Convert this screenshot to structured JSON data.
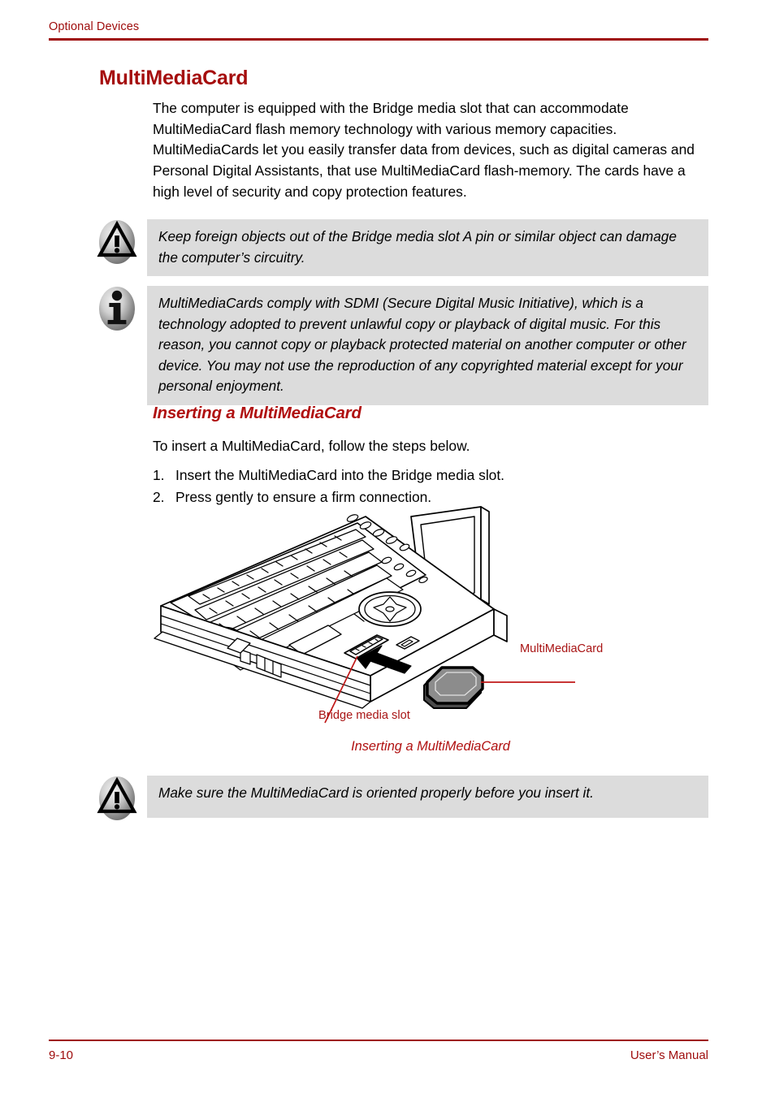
{
  "header": {
    "running_head": "Optional Devices",
    "rule_color": "#9E0B0B"
  },
  "heading": {
    "title": "MultiMediaCard",
    "color": "#A50D0D"
  },
  "intro": {
    "paragraph": "The computer is equipped with the Bridge media slot that can accommodate MultiMediaCard flash memory technology with various memory capacities. MultiMediaCards let you easily transfer data from devices, such as digital cameras and Personal Digital Assistants, that use MultiMediaCard flash-memory. The cards have a high level of security and copy protection features."
  },
  "callouts": {
    "caution_slot": {
      "icon": "warning-triangle-icon",
      "text": "Keep foreign objects out of the Bridge media slot A pin or similar object can damage the computer’s circuitry.",
      "background": "#DCDCDC"
    },
    "note_sdmi": {
      "icon": "info-i-icon",
      "text": "MultiMediaCards comply with SDMI (Secure Digital Music Initiative), which is a technology adopted to prevent unlawful copy or playback of digital music. For this reason, you cannot copy or playback protected material on another computer or other device. You may not use the reproduction of any copyrighted material except for your personal enjoyment.",
      "background": "#DCDCDC"
    },
    "caution_orientation": {
      "icon": "warning-triangle-icon",
      "text": "Make sure the MultiMediaCard is oriented properly before you insert it.",
      "background": "#DCDCDC"
    }
  },
  "subsection": {
    "title": "Inserting a MultiMediaCard",
    "lead": "To insert a MultiMediaCard, follow the steps below.",
    "steps": [
      {
        "num": "1.",
        "text": "Insert the MultiMediaCard into the Bridge media slot."
      },
      {
        "num": "2.",
        "text": "Press gently to ensure a firm connection."
      }
    ]
  },
  "figure": {
    "caption": "Inserting a MultiMediaCard",
    "labels": {
      "card": "MultiMediaCard",
      "slot": "Bridge media slot"
    },
    "leader_color": "#C01818",
    "card_fill": "#8C8C8C",
    "alt": "Line drawing of a notebook computer with a MultiMediaCard being inserted into the Bridge media slot"
  },
  "footer": {
    "page_number": "9-10",
    "manual_label": "User’s Manual",
    "color": "#9E0B0B"
  }
}
